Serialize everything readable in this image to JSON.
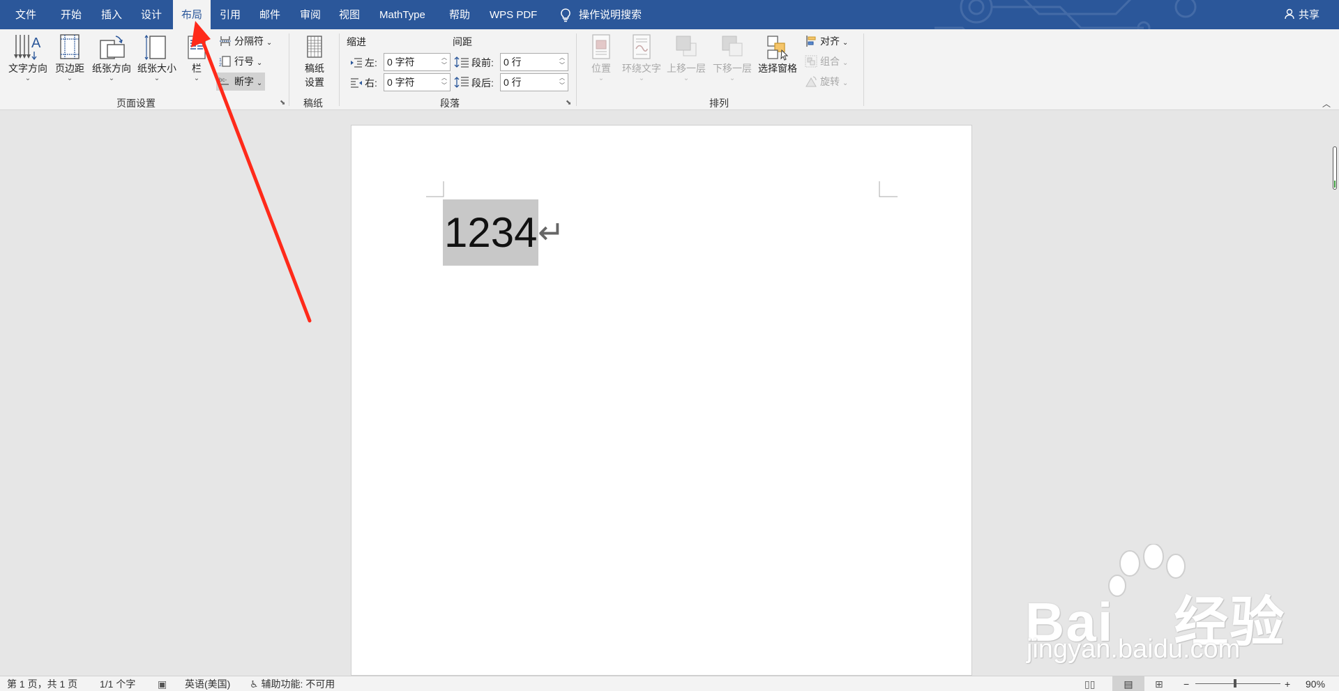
{
  "tabs": [
    "文件",
    "开始",
    "插入",
    "设计",
    "布局",
    "引用",
    "邮件",
    "审阅",
    "视图",
    "MathType",
    "帮助",
    "WPS PDF"
  ],
  "active_tab": "布局",
  "tell_me": "操作说明搜索",
  "share": "共享",
  "ribbon": {
    "page_setup": {
      "text_direction": "文字方向",
      "margins": "页边距",
      "orientation": "纸张方向",
      "size": "纸张大小",
      "columns": "栏",
      "breaks": "分隔符",
      "line_numbers": "行号",
      "hyphenation": "断字",
      "label": "页面设置"
    },
    "draft": {
      "button": "稿纸\n设置",
      "button_line1": "稿纸",
      "button_line2": "设置",
      "label": "稿纸"
    },
    "paragraph": {
      "indent_header": "缩进",
      "spacing_header": "间距",
      "left_label": "左:",
      "left_value": "0 字符",
      "right_label": "右:",
      "right_value": "0 字符",
      "before_label": "段前:",
      "before_value": "0 行",
      "after_label": "段后:",
      "after_value": "0 行",
      "label": "段落"
    },
    "arrange": {
      "position": "位置",
      "wrap_text": "环绕文字",
      "bring_forward": "上移一层",
      "send_backward": "下移一层",
      "selection_pane": "选择窗格",
      "align": "对齐",
      "group": "组合",
      "rotate": "旋转",
      "label": "排列"
    }
  },
  "document": {
    "text": "1234",
    "paragraph_mark": "↵"
  },
  "status_bar": {
    "page": "第 1 页，共 1 页",
    "words": "1/1 个字",
    "language": "英语(美国)",
    "accessibility": "辅助功能: 不可用",
    "zoom": "90%"
  },
  "watermark": {
    "brand": "Bai",
    "brand_tail": "经验",
    "url": "jingyan.baidu.com"
  },
  "colors": {
    "title_bar": "#2b579a",
    "ribbon_bg": "#f3f3f3",
    "annotation_arrow": "#ff2a1a"
  }
}
